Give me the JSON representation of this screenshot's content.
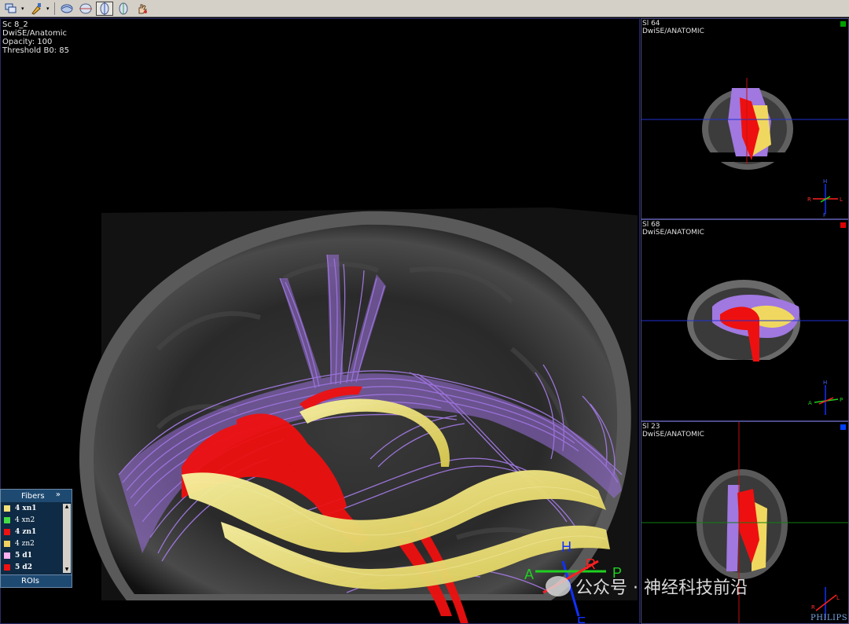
{
  "toolbar": {
    "buttons": [
      {
        "icon": "layers-icon"
      },
      {
        "icon": "brush-icon"
      },
      {
        "icon": "rotate-brain-icon"
      },
      {
        "icon": "axial-view-icon"
      },
      {
        "icon": "sagittal-view-icon",
        "active": true
      },
      {
        "icon": "coronal-view-icon"
      },
      {
        "icon": "hand-icon"
      }
    ]
  },
  "main_view": {
    "info_lines": [
      "Sc 8_2",
      "DwiSE/Anatomic",
      "Opacity: 100",
      "Threshold B0: 85"
    ],
    "orientation": {
      "h": "H",
      "f": "F",
      "a": "A",
      "p": "P",
      "r": "R"
    }
  },
  "side_views": [
    {
      "slice": "Sl 64",
      "series": "DwiSE/ANATOMIC",
      "marker_color": "#00a000"
    },
    {
      "slice": "Sl 68",
      "series": "DwiSE/ANATOMIC",
      "marker_color": "#e00000"
    },
    {
      "slice": "Sl 23",
      "series": "DwiSE/ANATOMIC",
      "marker_color": "#0040ff"
    }
  ],
  "fibers_panel": {
    "title": "Fibers",
    "chevron": "»",
    "items": [
      {
        "label": "4 xn1",
        "color": "#f4e07a",
        "bold": true
      },
      {
        "label": "4 xn2",
        "color": "#44dd44",
        "bold": false
      },
      {
        "label": "4 zn1",
        "color": "#ee1111",
        "bold": true
      },
      {
        "label": "4 zn2",
        "color": "#f0d060",
        "bold": false
      },
      {
        "label": "5 d1",
        "color": "#ffb0f0",
        "bold": true
      },
      {
        "label": "5 d2",
        "color": "#ee1111",
        "bold": true
      }
    ],
    "rois_label": "ROIs"
  },
  "watermark": "公众号 · 神经科技前沿",
  "brand": "PHILIPS",
  "colors": {
    "purple": "#a078e0",
    "red": "#ee1010",
    "yellow": "#ece070"
  }
}
